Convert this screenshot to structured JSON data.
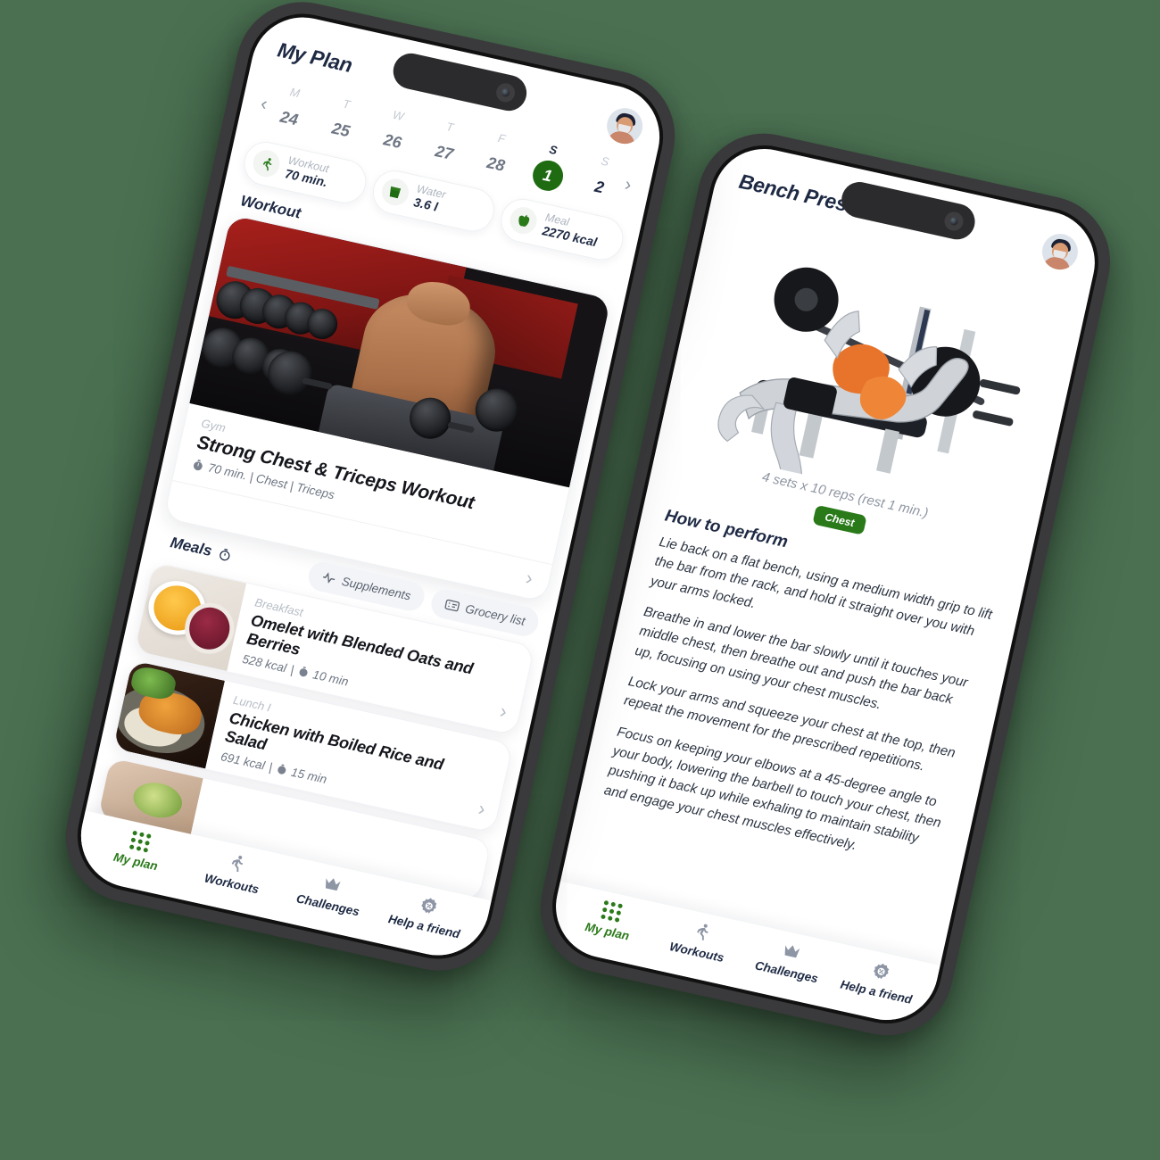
{
  "background_color": "#4A7051",
  "accent_green": "#1E6B12",
  "badge_green": "#2A7A1A",
  "phone_plan": {
    "header": {
      "title": "My Plan",
      "avatar_name": "user-avatar"
    },
    "calendar": {
      "prev_label": "‹",
      "next_label": "›",
      "days": [
        {
          "dow": "M",
          "num": "24",
          "selected": false,
          "weekend": false
        },
        {
          "dow": "T",
          "num": "25",
          "selected": false,
          "weekend": false
        },
        {
          "dow": "W",
          "num": "26",
          "selected": false,
          "weekend": false
        },
        {
          "dow": "T",
          "num": "27",
          "selected": false,
          "weekend": false
        },
        {
          "dow": "F",
          "num": "28",
          "selected": false,
          "weekend": false
        },
        {
          "dow": "S",
          "num": "1",
          "selected": true,
          "weekend": true
        },
        {
          "dow": "S",
          "num": "2",
          "selected": false,
          "weekend": true
        }
      ]
    },
    "stats": [
      {
        "icon": "running-icon",
        "label": "Workout",
        "value": "70 min."
      },
      {
        "icon": "water-glass-icon",
        "label": "Water",
        "value": "3.6 l"
      },
      {
        "icon": "apple-icon",
        "label": "Meal",
        "value": "2270 kcal"
      }
    ],
    "workout_section": {
      "title": "Workout",
      "card": {
        "eyebrow": "Gym",
        "title": "Strong Chest & Triceps Workout",
        "meta": "70 min. | Chest | Triceps",
        "chevron": "›"
      }
    },
    "meals_section": {
      "title": "Meals",
      "chips": [
        {
          "icon": "activity-pulse-icon",
          "label": "Supplements"
        },
        {
          "icon": "list-card-icon",
          "label": "Grocery list"
        }
      ],
      "items": [
        {
          "eyebrow": "Breakfast",
          "title": "Omelet with Blended Oats and Berries",
          "meta": "528 kcal | 10 min",
          "kcal": "528 kcal",
          "time": "10 min",
          "chevron": "›"
        },
        {
          "eyebrow": "Lunch I",
          "title": "Chicken with Boiled Rice and Salad",
          "meta": "691 kcal | 15 min",
          "kcal": "691 kcal",
          "time": "15 min",
          "chevron": "›"
        }
      ]
    }
  },
  "phone_detail": {
    "header": {
      "title": "Bench Press",
      "avatar_name": "user-avatar"
    },
    "exercise": {
      "illustration_name": "bench-press-anatomy-illustration",
      "sets_reps": "4 sets x 10 reps (rest 1 min.)",
      "muscle_badge": "Chest",
      "how_to_heading": "How to perform",
      "paragraphs": [
        "Lie back on a flat bench, using a medium width grip to lift the bar from the rack, and hold it straight over you with your arms locked.",
        "Breathe in and lower the bar slowly until it touches your middle chest, then breathe out and push the bar back up, focusing on using your chest muscles.",
        "Lock your arms and squeeze your chest at the top, then repeat the movement for the prescribed repetitions.",
        "Focus on keeping your elbows at a 45-degree angle to your body, lowering the barbell to touch your chest, then pushing it back up while exhaling to maintain stability and engage your chest muscles effectively."
      ]
    }
  },
  "tabbar": {
    "items": [
      {
        "icon": "grid-dots-icon",
        "label": "My plan",
        "active": true
      },
      {
        "icon": "running-icon",
        "label": "Workouts",
        "active": false
      },
      {
        "icon": "crown-icon",
        "label": "Challenges",
        "active": false
      },
      {
        "icon": "badge-gift-icon",
        "label": "Help a friend",
        "active": false
      }
    ]
  }
}
